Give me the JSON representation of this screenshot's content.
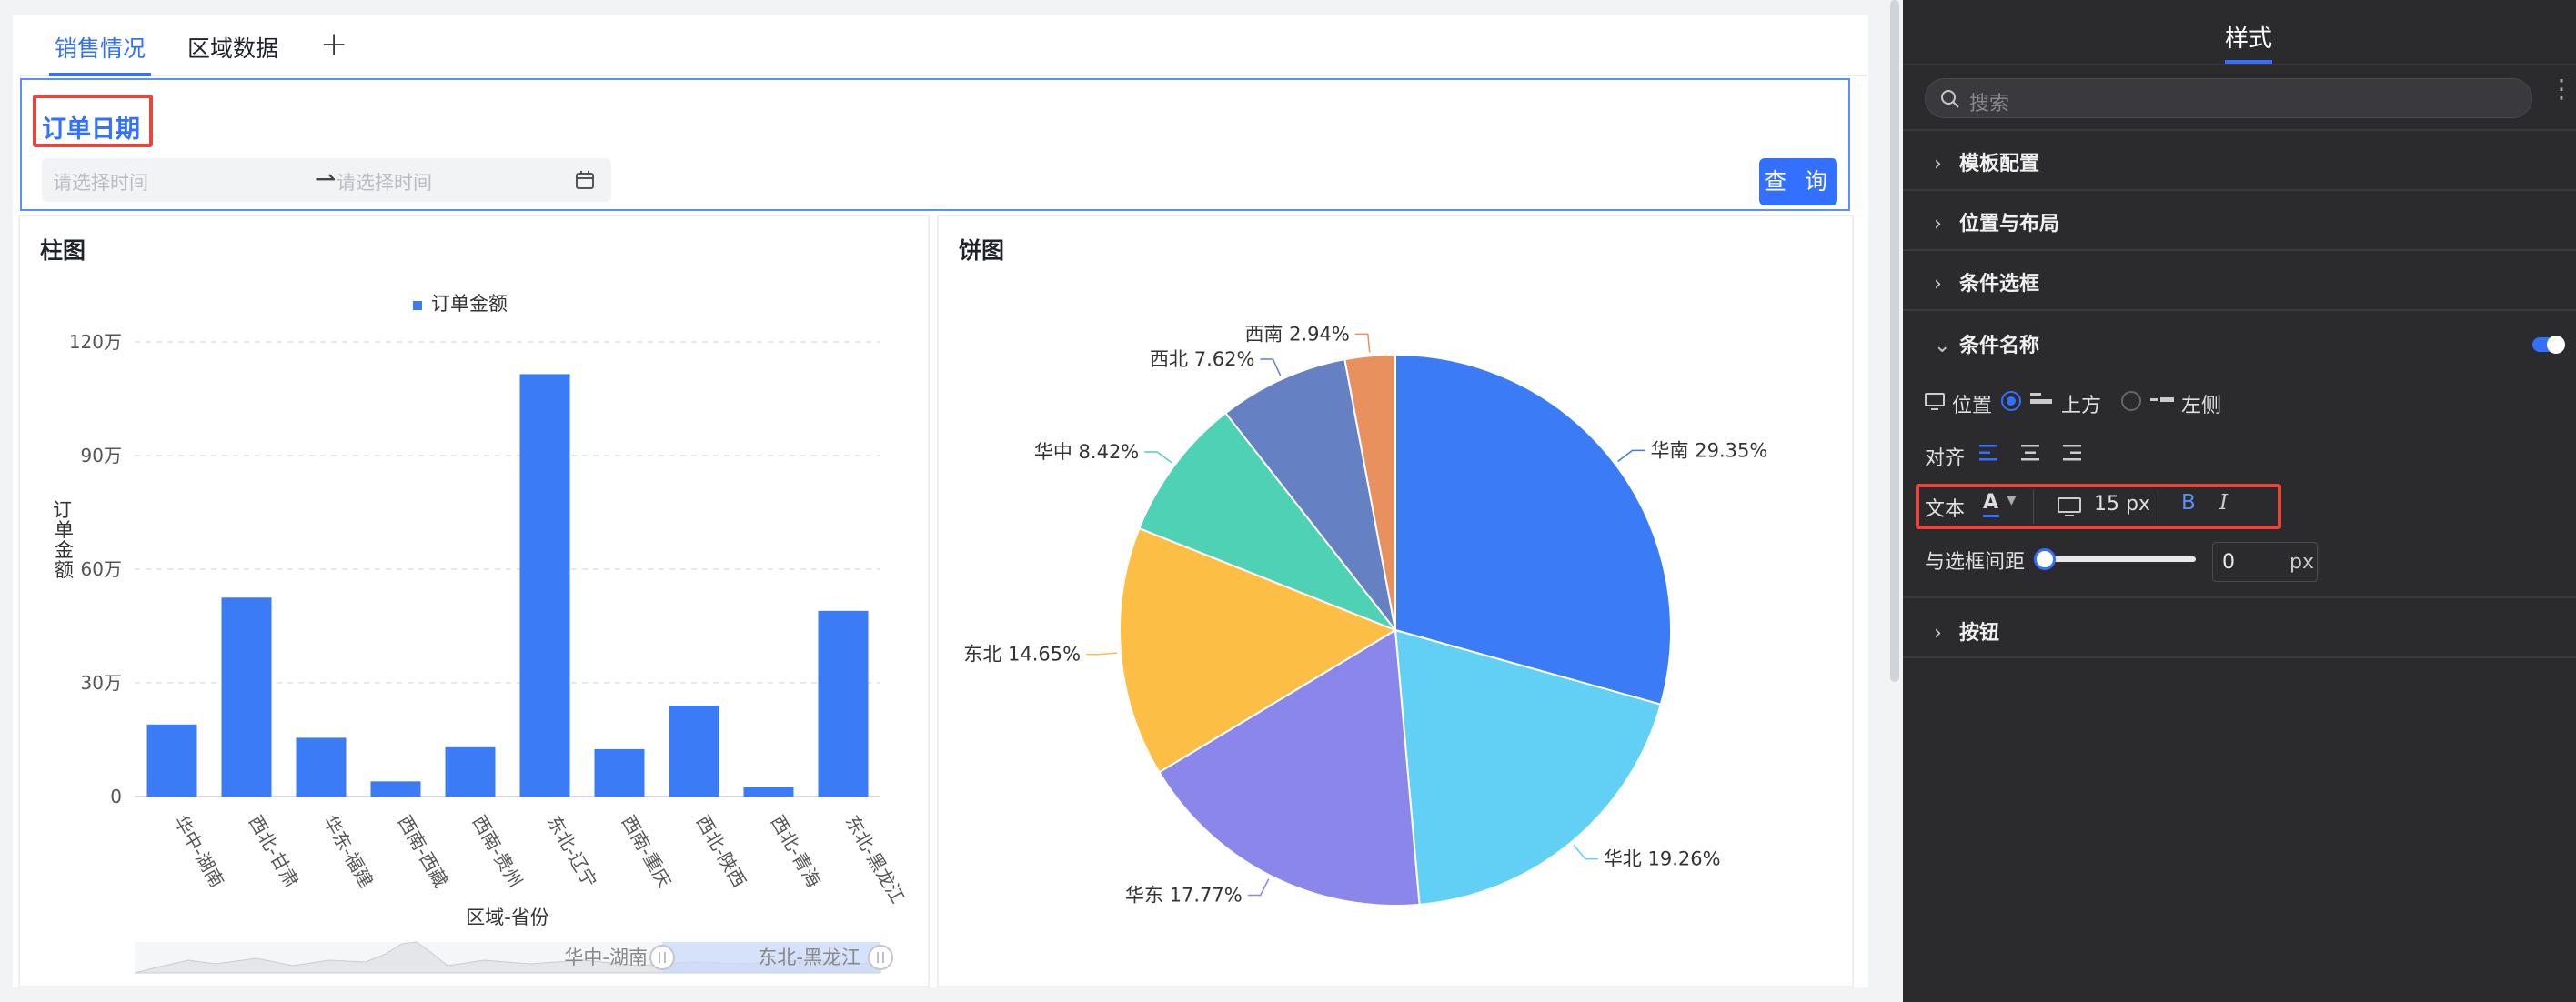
{
  "tabs": [
    {
      "label": "销售情况",
      "active": true
    },
    {
      "label": "区域数据",
      "active": false
    }
  ],
  "tab_add_label": "+",
  "filter": {
    "title": "订单日期",
    "start_placeholder": "请选择时间",
    "end_placeholder": "请选择时间",
    "query_label": "查 询"
  },
  "bar_panel": {
    "title": "柱图"
  },
  "pie_panel": {
    "title": "饼图"
  },
  "chart_data": [
    {
      "type": "bar",
      "legend": [
        "订单金额"
      ],
      "categories": [
        "华中-湖南",
        "西北-甘肃",
        "华东-福建",
        "西南-西藏",
        "西南-贵州",
        "东北-辽宁",
        "西南-重庆",
        "西北-陕西",
        "西北-青海",
        "东北-黑龙江"
      ],
      "series": [
        {
          "name": "订单金额",
          "values": [
            190000,
            525000,
            155000,
            40000,
            130000,
            1115000,
            125000,
            240000,
            25000,
            490000
          ]
        }
      ],
      "yticks": [
        "0",
        "30万",
        "60万",
        "90万",
        "120万"
      ],
      "ylim": [
        0,
        1200000
      ],
      "xlabel": "区域-省份",
      "ylabel": "订单金额",
      "zoom_start_label": "华中-湖南",
      "zoom_end_label": "东北-黑龙江",
      "color": "#3b7bf6"
    },
    {
      "type": "pie",
      "slices": [
        {
          "label": "华南 29.35%",
          "value": 29.35,
          "color": "#3b7bf6"
        },
        {
          "label": "华北 19.26%",
          "value": 19.26,
          "color": "#62d0f5"
        },
        {
          "label": "华东 17.77%",
          "value": 17.77,
          "color": "#8b86ea"
        },
        {
          "label": "东北 14.65%",
          "value": 14.65,
          "color": "#fdbe46"
        },
        {
          "label": "华中 8.42%",
          "value": 8.42,
          "color": "#4fd1b5"
        },
        {
          "label": "西北 7.62%",
          "value": 7.62,
          "color": "#6581c3"
        },
        {
          "label": "西南 2.94%",
          "value": 2.94,
          "color": "#e8915f"
        }
      ]
    }
  ],
  "right_panel": {
    "title": "样式",
    "search_placeholder": "搜索",
    "sections": [
      "模板配置",
      "位置与布局",
      "条件选框",
      "条件名称",
      "按钮"
    ],
    "position_label": "位置",
    "position_opt_top": "上方",
    "position_opt_left": "左侧",
    "align_label": "对齐",
    "text_label": "文本",
    "font_size": "15 px",
    "bold_label": "B",
    "italic_label": "I",
    "gap_label": "与选框间距",
    "gap_value": "0",
    "gap_unit": "px",
    "accent": "#3370ff"
  }
}
